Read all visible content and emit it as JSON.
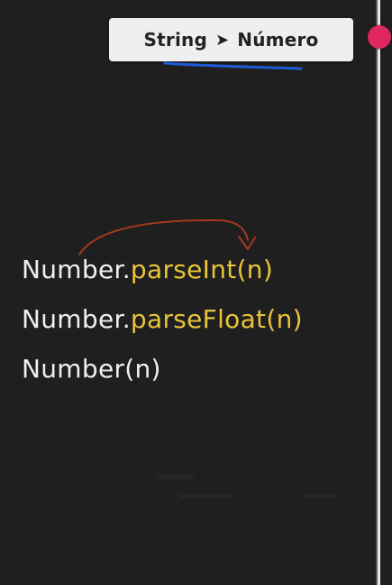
{
  "title_card": {
    "left": "String",
    "arrow": "➤",
    "right": "Número"
  },
  "code": {
    "line1": {
      "object": "Number.",
      "method": "parseInt",
      "args": "(n)"
    },
    "line2": {
      "object": "Number.",
      "method": "parseFloat",
      "args": "(n)"
    },
    "line3": {
      "object": "Number",
      "args": "(n)"
    }
  },
  "colors": {
    "background": "#1f1f1f",
    "code_text": "#f0f0f0",
    "method": "#e8c43a",
    "underline": "#1e5ad6",
    "arrow_annotation": "#a13a1c",
    "record_dot": "#e0265f",
    "card": "#efefef"
  }
}
